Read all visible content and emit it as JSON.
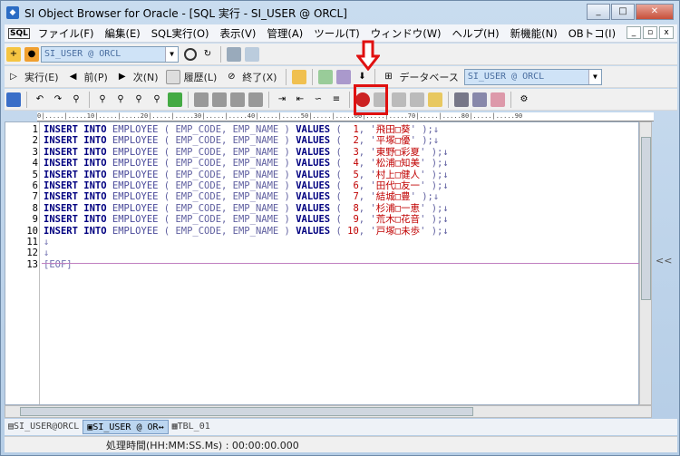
{
  "window": {
    "title": "SI Object Browser for Oracle - [SQL 実行 - SI_USER @ ORCL]",
    "min": "_",
    "max": "□",
    "close": "✕"
  },
  "menu": [
    "ファイル(F)",
    "編集(E)",
    "SQL実行(O)",
    "表示(V)",
    "管理(A)",
    "ツール(T)",
    "ウィンドウ(W)",
    "ヘルプ(H)",
    "新機能(N)",
    "OBトコ(I)"
  ],
  "toolbar1": {
    "connection": "SI_USER @ ORCL"
  },
  "toolbar2": {
    "run": "実行(E)",
    "prev": "前(P)",
    "next": "次(N)",
    "history": "履歴(L)",
    "end": "終了(X)",
    "database_label": "データベース",
    "database_value": "SI_USER @ ORCL"
  },
  "ruler": "0|.....|.....10|.....|.....20|.....|.....30|.....|.....40|.....|.....50|.....|.....60|.....|.....70|.....|.....80|.....|.....90",
  "editor_lines": [
    {
      "n": "1",
      "code": "1",
      "name": "飛田□葵"
    },
    {
      "n": "2",
      "code": "2",
      "name": "平塚□優"
    },
    {
      "n": "3",
      "code": "3",
      "name": "東野□彩夏"
    },
    {
      "n": "4",
      "code": "4",
      "name": "松浦□知美"
    },
    {
      "n": "5",
      "code": "5",
      "name": "村上□健人"
    },
    {
      "n": "6",
      "code": "6",
      "name": "田代□友一"
    },
    {
      "n": "7",
      "code": "7",
      "name": "結城□豊"
    },
    {
      "n": "8",
      "code": "8",
      "name": "杉浦□一恵"
    },
    {
      "n": "9",
      "code": "9",
      "name": "荒木□花音"
    },
    {
      "n": "10",
      "code": "10",
      "name": "戸塚□未歩"
    }
  ],
  "code_parts": {
    "insert": "INSERT",
    "into": "INTO",
    "table": "EMPLOYEE",
    "cols": "( EMP_CODE, EMP_NAME )",
    "values": "VALUES",
    "eol": "↓"
  },
  "eof_lines": [
    {
      "n": "11",
      "text": "↓"
    },
    {
      "n": "12",
      "text": "↓"
    },
    {
      "n": "13",
      "text": "[EOF]"
    }
  ],
  "side_toggle": "<<",
  "tabs": [
    {
      "label": "SI_USER@ORCL"
    },
    {
      "label": "SI_USER @ OR"
    },
    {
      "label": "TBL_01"
    }
  ],
  "tab_separator": "↔",
  "status": "処理時間(HH:MM:SS.Ms) : 00:00:00.000",
  "callout_arrow": "⇩"
}
